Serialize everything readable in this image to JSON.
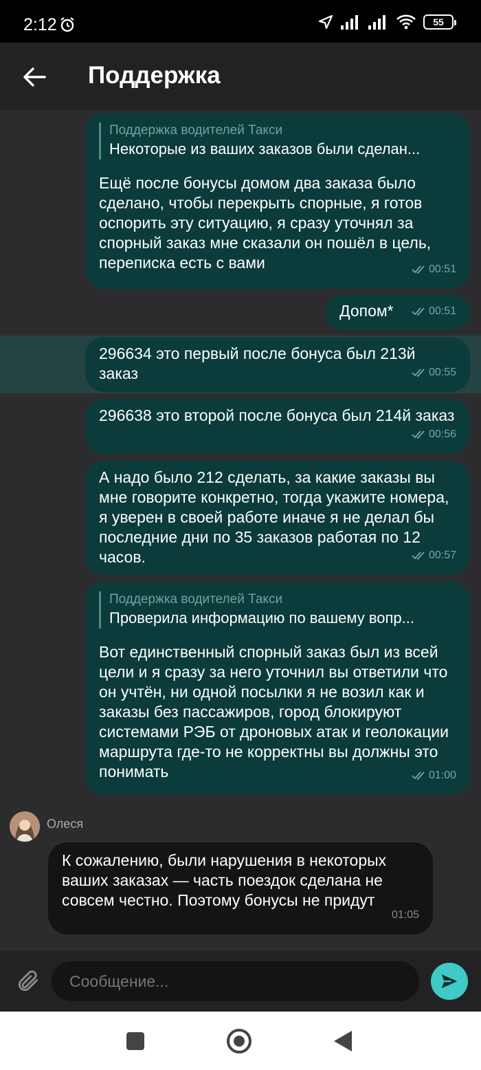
{
  "status_bar": {
    "time": "2:12",
    "battery": "55"
  },
  "header": {
    "title": "Поддержка"
  },
  "messages": [
    {
      "quote_author": "Поддержка водителей Такси",
      "quote_text": "Некоторые из ваших заказов были сделан...",
      "text": "Ещё после бонусы домом два заказа было сделано, чтобы перекрыть спорные, я готов оспорить эту ситуацию, я сразу уточнял за спорный заказ мне сказали он пошёл в цель, переписка есть с вами",
      "time": "00:51"
    },
    {
      "text": "Допом*",
      "time": "00:51"
    },
    {
      "text": "296634 это первый после бонуса был 213й заказ",
      "time": "00:55"
    },
    {
      "text": "296638 это второй после бонуса был 214й заказ",
      "time": "00:56"
    },
    {
      "text": "А надо было 212 сделать, за какие заказы вы мне говорите конкретно, тогда укажите номера, я уверен в своей работе иначе я не делал бы последние дни по 35 заказов работая по 12 часов.",
      "time": "00:57"
    },
    {
      "quote_author": "Поддержка водителей Такси",
      "quote_text": "Проверила информацию по вашему вопр...",
      "text": "Вот единственный спорный заказ был из всей цели и я сразу за него уточнил вы ответили что он учтён, ни одной посылки я не возил как и заказы без пассажиров, город блокируют системами РЭБ от дроновых атак и геолокации маршрута где-то не корректны вы должны это понимать",
      "time": "01:00"
    }
  ],
  "incoming": {
    "sender": "Олеся",
    "text": "К сожалению, были нарушения в некоторых ваших заказах — часть поездок сделана не совсем честно. Поэтому бонусы не придут",
    "time": "01:05"
  },
  "composer": {
    "placeholder": "Сообщение..."
  },
  "colors": {
    "outgoing_bubble": "#0b3b3b",
    "incoming_bubble": "#141414",
    "accent": "#3fc9c7",
    "background": "#2c2c2e"
  }
}
